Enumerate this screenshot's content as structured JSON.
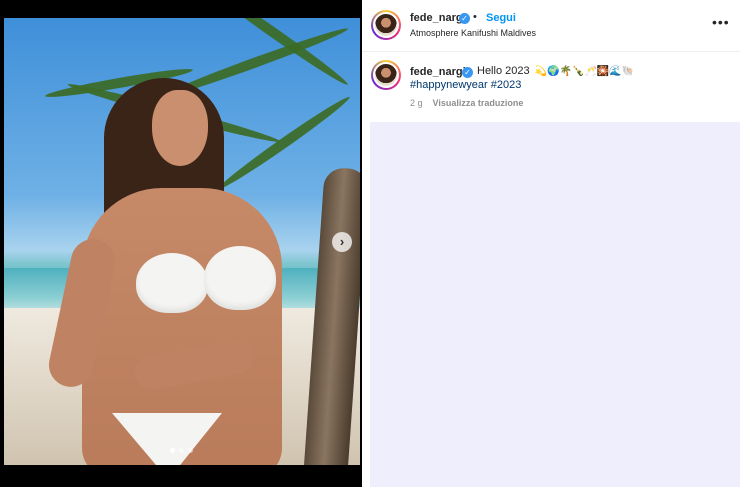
{
  "post": {
    "username": "fede_nargi",
    "separator": "•",
    "follow_label": "Segui",
    "location": "Atmosphere Kanifushi Maldives",
    "more_label": "•••",
    "caption_text": "Hello 2023",
    "caption_emojis": "💫🌍🌴🍾🥂🎇🌊🐚",
    "hashtags": "#happynewyear #2023",
    "age": "2 g",
    "translate_label": "Visualizza traduzione",
    "verified_glyph": "✓"
  },
  "carousel": {
    "next_glyph": "›",
    "slides_total": 3,
    "active_slide": 1
  },
  "icons": {
    "verified": "verified-badge-icon",
    "more": "more-options-icon",
    "next": "chevron-right-icon"
  },
  "colors": {
    "link_blue": "#0095f6",
    "hashtag_blue": "#00376b",
    "verified_blue": "#3897f0",
    "comments_bg": "#eeeefc"
  }
}
